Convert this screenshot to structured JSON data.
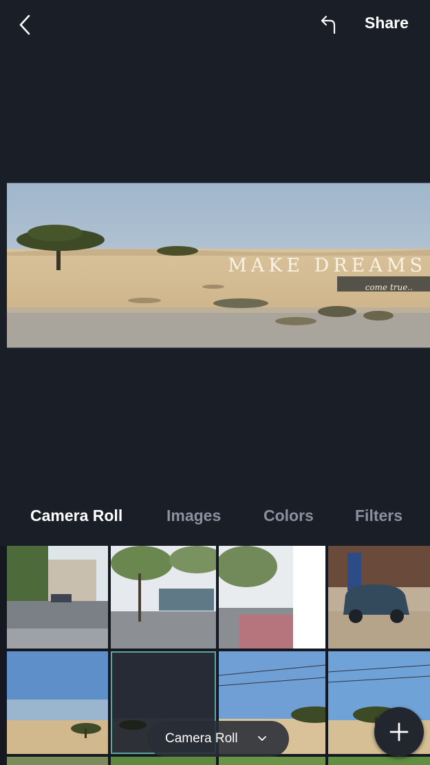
{
  "header": {
    "back_icon": "chevron-left-icon",
    "undo_icon": "undo-arrow-icon",
    "share_label": "Share"
  },
  "canvas": {
    "title": "MAKE DREAMS",
    "subtitle": "come true.."
  },
  "tabs": [
    {
      "label": "Camera Roll",
      "active": true
    },
    {
      "label": "Images",
      "active": false
    },
    {
      "label": "Colors",
      "active": false
    },
    {
      "label": "Filters",
      "active": false
    }
  ],
  "album_picker": {
    "label": "Camera Roll",
    "icon": "chevron-down-icon"
  },
  "fab": {
    "icon": "plus-icon"
  },
  "colors": {
    "background": "#1a1e27",
    "tab_active": "#ffffff",
    "tab_inactive": "#8b909e",
    "selected_border": "#5fa8a0"
  }
}
